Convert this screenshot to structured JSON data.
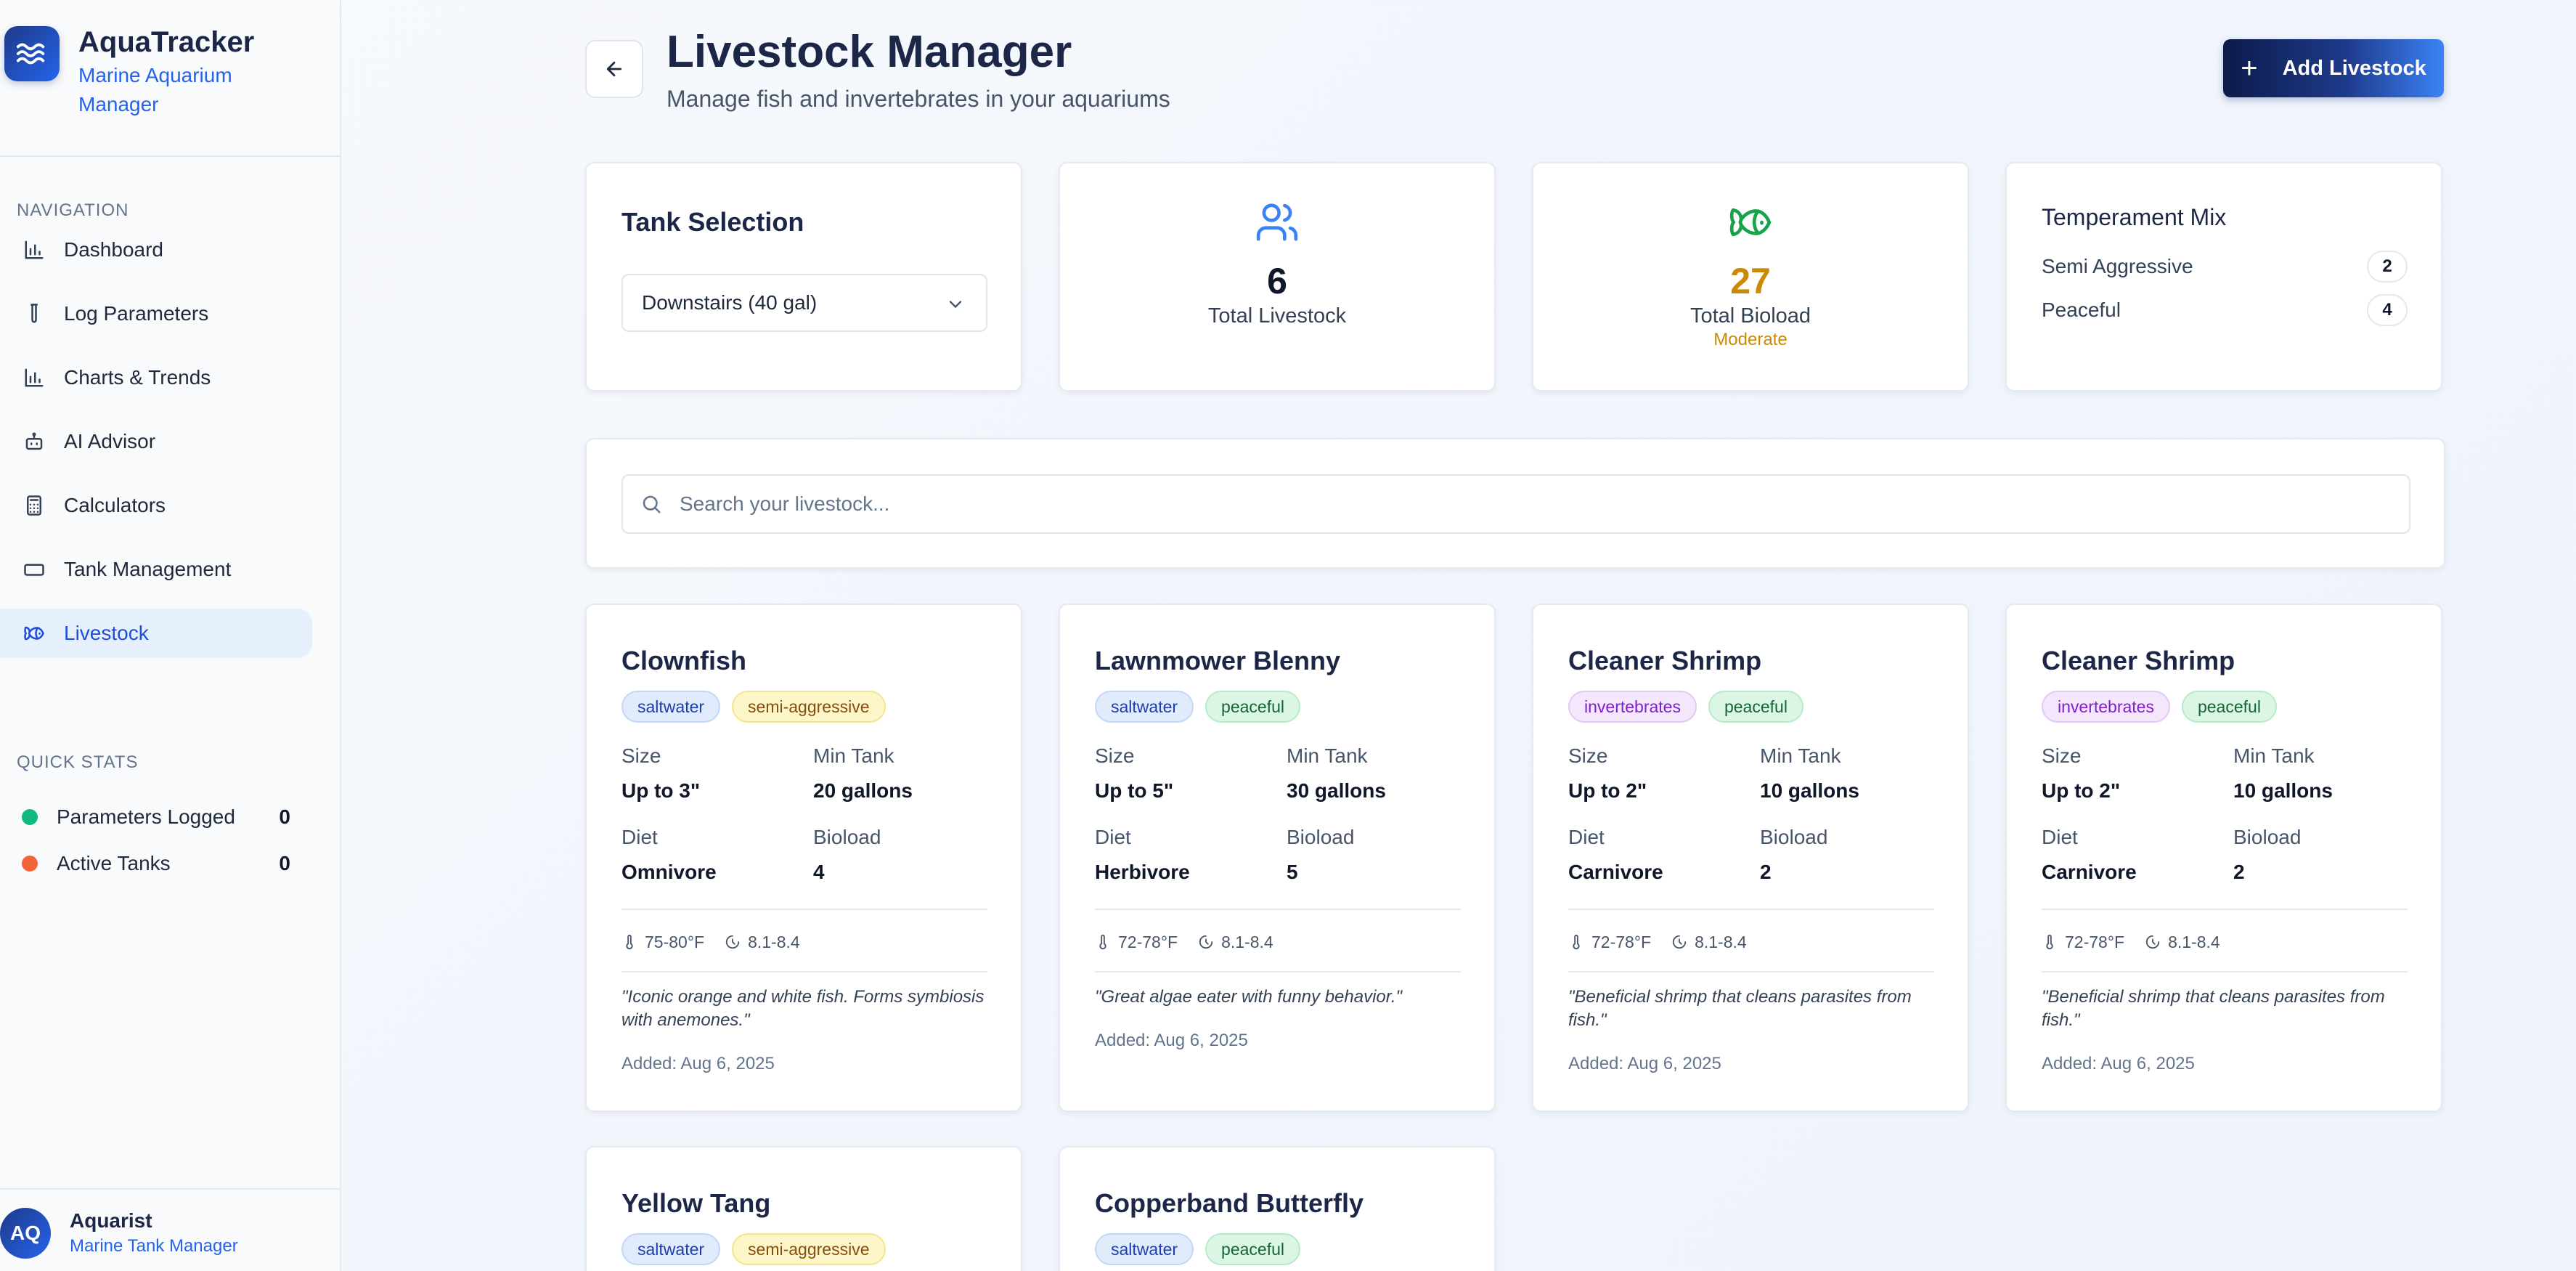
{
  "brand": {
    "name": "AquaTracker",
    "subtitle": "Marine Aquarium Manager"
  },
  "sidebar": {
    "nav_label": "NAVIGATION",
    "items": [
      {
        "label": "Dashboard",
        "icon": "bar-chart-icon"
      },
      {
        "label": "Log Parameters",
        "icon": "test-tube-icon"
      },
      {
        "label": "Charts & Trends",
        "icon": "bar-chart-icon"
      },
      {
        "label": "AI Advisor",
        "icon": "bot-icon"
      },
      {
        "label": "Calculators",
        "icon": "calculator-icon"
      },
      {
        "label": "Tank Management",
        "icon": "tank-icon"
      },
      {
        "label": "Livestock",
        "icon": "fish-icon",
        "active": true
      }
    ],
    "quick_stats_label": "QUICK STATS",
    "quick_stats": [
      {
        "label": "Parameters Logged",
        "value": "0",
        "color": "#10b981"
      },
      {
        "label": "Active Tanks",
        "value": "0",
        "color": "#f4623a"
      }
    ],
    "user": {
      "initials": "AQ",
      "name": "Aquarist",
      "role": "Marine Tank Manager"
    }
  },
  "header": {
    "title": "Livestock Manager",
    "subtitle": "Manage fish and invertebrates in your aquariums",
    "add_button": "Add Livestock"
  },
  "tank_selection": {
    "title": "Tank Selection",
    "selected": "Downstairs (40 gal)"
  },
  "stats": {
    "total_livestock": {
      "value": "6",
      "label": "Total Livestock"
    },
    "total_bioload": {
      "value": "27",
      "label": "Total Bioload",
      "hint": "Moderate"
    }
  },
  "temperament": {
    "title": "Temperament Mix",
    "rows": [
      {
        "label": "Semi Aggressive",
        "count": "2"
      },
      {
        "label": "Peaceful",
        "count": "4"
      }
    ]
  },
  "search": {
    "placeholder": "Search your livestock..."
  },
  "labels": {
    "size": "Size",
    "min_tank": "Min Tank",
    "diet": "Diet",
    "bioload": "Bioload"
  },
  "livestock": [
    {
      "name": "Clownfish",
      "type": "saltwater",
      "temperament": "semi-aggressive",
      "size": "Up to 3\"",
      "min_tank": "20 gallons",
      "diet": "Omnivore",
      "bioload": "4",
      "temp": "75-80°F",
      "ph": "8.1-8.4",
      "notes": "\"Iconic orange and white fish. Forms symbiosis with anemones.\"",
      "added": "Added: Aug 6, 2025"
    },
    {
      "name": "Lawnmower Blenny",
      "type": "saltwater",
      "temperament": "peaceful",
      "size": "Up to 5\"",
      "min_tank": "30 gallons",
      "diet": "Herbivore",
      "bioload": "5",
      "temp": "72-78°F",
      "ph": "8.1-8.4",
      "notes": "\"Great algae eater with funny behavior.\"",
      "added": "Added: Aug 6, 2025"
    },
    {
      "name": "Cleaner Shrimp",
      "type": "invertebrates",
      "temperament": "peaceful",
      "size": "Up to 2\"",
      "min_tank": "10 gallons",
      "diet": "Carnivore",
      "bioload": "2",
      "temp": "72-78°F",
      "ph": "8.1-8.4",
      "notes": "\"Beneficial shrimp that cleans parasites from fish.\"",
      "added": "Added: Aug 6, 2025"
    },
    {
      "name": "Cleaner Shrimp",
      "type": "invertebrates",
      "temperament": "peaceful",
      "size": "Up to 2\"",
      "min_tank": "10 gallons",
      "diet": "Carnivore",
      "bioload": "2",
      "temp": "72-78°F",
      "ph": "8.1-8.4",
      "notes": "\"Beneficial shrimp that cleans parasites from fish.\"",
      "added": "Added: Aug 6, 2025"
    },
    {
      "name": "Yellow Tang",
      "type": "saltwater",
      "temperament": "semi-aggressive"
    },
    {
      "name": "Copperband Butterfly",
      "type": "saltwater",
      "temperament": "peaceful"
    }
  ]
}
